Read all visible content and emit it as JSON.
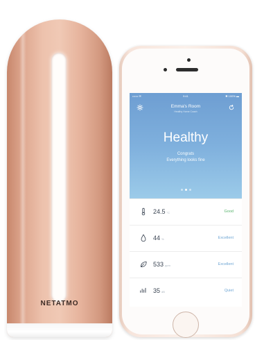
{
  "device": {
    "brand": "NETATMO",
    "color": "#e5ae96"
  },
  "phone": {
    "status_bar": {
      "carrier": "•••••• ✉",
      "time": "9:41",
      "battery": "✱ 100% ▬"
    },
    "header": {
      "title": "Emma's Room",
      "subtitle": "Healthy Home Coach",
      "left_icon": "gear-icon",
      "right_icon": "refresh-icon"
    },
    "status": {
      "label": "Healthy",
      "message_line1": "Congrats",
      "message_line2": "Everything looks fine"
    },
    "metrics": [
      {
        "icon": "thermometer-icon",
        "value": "24.5",
        "unit": "°C",
        "status": "Good"
      },
      {
        "icon": "humidity-drop-icon",
        "value": "44",
        "unit": "%",
        "status": "Excellent"
      },
      {
        "icon": "air-quality-leaf-icon",
        "value": "533",
        "unit": "ppm",
        "status": "Excellent"
      },
      {
        "icon": "noise-level-icon",
        "value": "35",
        "unit": "dB",
        "status": "Quiet"
      }
    ],
    "colors": {
      "gradient_top": "#6e9ed2",
      "gradient_bottom": "#9ccbe9",
      "good": "#58b36d",
      "excellent": "#6fa6d4"
    }
  }
}
